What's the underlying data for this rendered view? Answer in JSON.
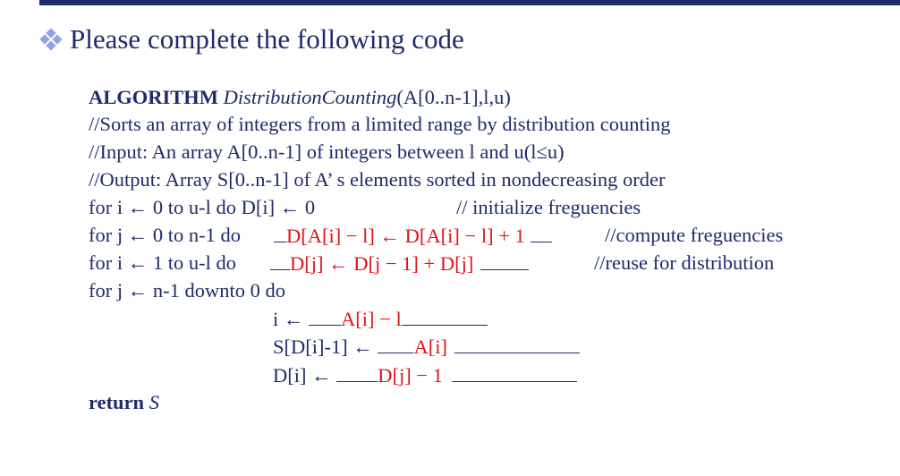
{
  "title": "Please complete the following code",
  "algorithm": {
    "keyword": "ALGORITHM",
    "name": "DistributionCounting",
    "params": "(A[0..n-1],l,u)"
  },
  "comments": [
    "//Sorts an array of integers from a limited range by distribution counting",
    "//Input: An array A[0..n-1] of integers between l and u(l≤u)",
    "//Output: Array S[0..n-1] of A’ s elements sorted in nondecreasing order"
  ],
  "loop1": {
    "code": "for i ← 0 to u-l do D[i] ← 0",
    "comment": "// initialize freguencies"
  },
  "loop2": {
    "head": "for j ← 0 to n-1 do",
    "answer": "D[A[i] − l] ← D[A[i] − l] + 1",
    "comment": "//compute freguencies"
  },
  "loop3": {
    "head": "for i ← 1 to u-l do",
    "answer": "D[j] ← D[j − 1] + D[j]",
    "comment": "//reuse for distribution"
  },
  "loop4": {
    "head": "for j ← n-1 downto 0 do"
  },
  "body": [
    {
      "lhs": "i ←",
      "answer": "A[i] − l"
    },
    {
      "lhs": "S[D[i]-1] ←",
      "answer": "A[i]"
    },
    {
      "lhs": "D[i] ←",
      "answer": "D[j] − 1"
    }
  ],
  "return": {
    "keyword": "return",
    "value": "S"
  },
  "colors": {
    "text": "#1f2a6b",
    "answer": "#e0141a",
    "bullet": "#8ea6e0"
  }
}
